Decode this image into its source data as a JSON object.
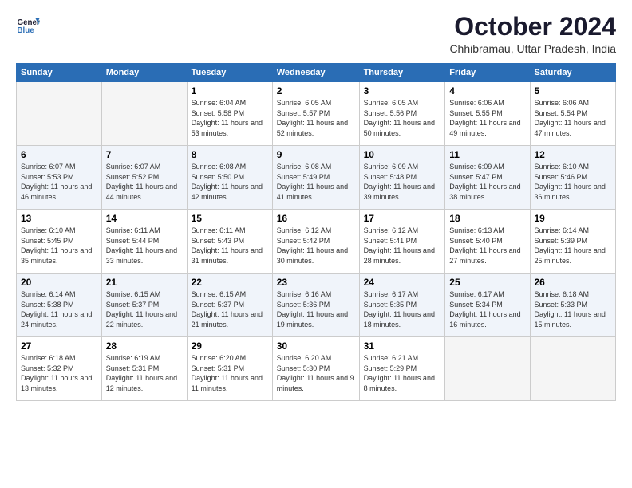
{
  "header": {
    "logo_line1": "General",
    "logo_line2": "Blue",
    "month_title": "October 2024",
    "subtitle": "Chhibramau, Uttar Pradesh, India"
  },
  "days_of_week": [
    "Sunday",
    "Monday",
    "Tuesday",
    "Wednesday",
    "Thursday",
    "Friday",
    "Saturday"
  ],
  "weeks": [
    [
      {
        "day": "",
        "empty": true
      },
      {
        "day": "",
        "empty": true
      },
      {
        "day": "1",
        "sunrise": "6:04 AM",
        "sunset": "5:58 PM",
        "daylight": "11 hours and 53 minutes."
      },
      {
        "day": "2",
        "sunrise": "6:05 AM",
        "sunset": "5:57 PM",
        "daylight": "11 hours and 52 minutes."
      },
      {
        "day": "3",
        "sunrise": "6:05 AM",
        "sunset": "5:56 PM",
        "daylight": "11 hours and 50 minutes."
      },
      {
        "day": "4",
        "sunrise": "6:06 AM",
        "sunset": "5:55 PM",
        "daylight": "11 hours and 49 minutes."
      },
      {
        "day": "5",
        "sunrise": "6:06 AM",
        "sunset": "5:54 PM",
        "daylight": "11 hours and 47 minutes."
      }
    ],
    [
      {
        "day": "6",
        "sunrise": "6:07 AM",
        "sunset": "5:53 PM",
        "daylight": "11 hours and 46 minutes."
      },
      {
        "day": "7",
        "sunrise": "6:07 AM",
        "sunset": "5:52 PM",
        "daylight": "11 hours and 44 minutes."
      },
      {
        "day": "8",
        "sunrise": "6:08 AM",
        "sunset": "5:50 PM",
        "daylight": "11 hours and 42 minutes."
      },
      {
        "day": "9",
        "sunrise": "6:08 AM",
        "sunset": "5:49 PM",
        "daylight": "11 hours and 41 minutes."
      },
      {
        "day": "10",
        "sunrise": "6:09 AM",
        "sunset": "5:48 PM",
        "daylight": "11 hours and 39 minutes."
      },
      {
        "day": "11",
        "sunrise": "6:09 AM",
        "sunset": "5:47 PM",
        "daylight": "11 hours and 38 minutes."
      },
      {
        "day": "12",
        "sunrise": "6:10 AM",
        "sunset": "5:46 PM",
        "daylight": "11 hours and 36 minutes."
      }
    ],
    [
      {
        "day": "13",
        "sunrise": "6:10 AM",
        "sunset": "5:45 PM",
        "daylight": "11 hours and 35 minutes."
      },
      {
        "day": "14",
        "sunrise": "6:11 AM",
        "sunset": "5:44 PM",
        "daylight": "11 hours and 33 minutes."
      },
      {
        "day": "15",
        "sunrise": "6:11 AM",
        "sunset": "5:43 PM",
        "daylight": "11 hours and 31 minutes."
      },
      {
        "day": "16",
        "sunrise": "6:12 AM",
        "sunset": "5:42 PM",
        "daylight": "11 hours and 30 minutes."
      },
      {
        "day": "17",
        "sunrise": "6:12 AM",
        "sunset": "5:41 PM",
        "daylight": "11 hours and 28 minutes."
      },
      {
        "day": "18",
        "sunrise": "6:13 AM",
        "sunset": "5:40 PM",
        "daylight": "11 hours and 27 minutes."
      },
      {
        "day": "19",
        "sunrise": "6:14 AM",
        "sunset": "5:39 PM",
        "daylight": "11 hours and 25 minutes."
      }
    ],
    [
      {
        "day": "20",
        "sunrise": "6:14 AM",
        "sunset": "5:38 PM",
        "daylight": "11 hours and 24 minutes."
      },
      {
        "day": "21",
        "sunrise": "6:15 AM",
        "sunset": "5:37 PM",
        "daylight": "11 hours and 22 minutes."
      },
      {
        "day": "22",
        "sunrise": "6:15 AM",
        "sunset": "5:37 PM",
        "daylight": "11 hours and 21 minutes."
      },
      {
        "day": "23",
        "sunrise": "6:16 AM",
        "sunset": "5:36 PM",
        "daylight": "11 hours and 19 minutes."
      },
      {
        "day": "24",
        "sunrise": "6:17 AM",
        "sunset": "5:35 PM",
        "daylight": "11 hours and 18 minutes."
      },
      {
        "day": "25",
        "sunrise": "6:17 AM",
        "sunset": "5:34 PM",
        "daylight": "11 hours and 16 minutes."
      },
      {
        "day": "26",
        "sunrise": "6:18 AM",
        "sunset": "5:33 PM",
        "daylight": "11 hours and 15 minutes."
      }
    ],
    [
      {
        "day": "27",
        "sunrise": "6:18 AM",
        "sunset": "5:32 PM",
        "daylight": "11 hours and 13 minutes."
      },
      {
        "day": "28",
        "sunrise": "6:19 AM",
        "sunset": "5:31 PM",
        "daylight": "11 hours and 12 minutes."
      },
      {
        "day": "29",
        "sunrise": "6:20 AM",
        "sunset": "5:31 PM",
        "daylight": "11 hours and 11 minutes."
      },
      {
        "day": "30",
        "sunrise": "6:20 AM",
        "sunset": "5:30 PM",
        "daylight": "11 hours and 9 minutes."
      },
      {
        "day": "31",
        "sunrise": "6:21 AM",
        "sunset": "5:29 PM",
        "daylight": "11 hours and 8 minutes."
      },
      {
        "day": "",
        "empty": true
      },
      {
        "day": "",
        "empty": true
      }
    ]
  ]
}
